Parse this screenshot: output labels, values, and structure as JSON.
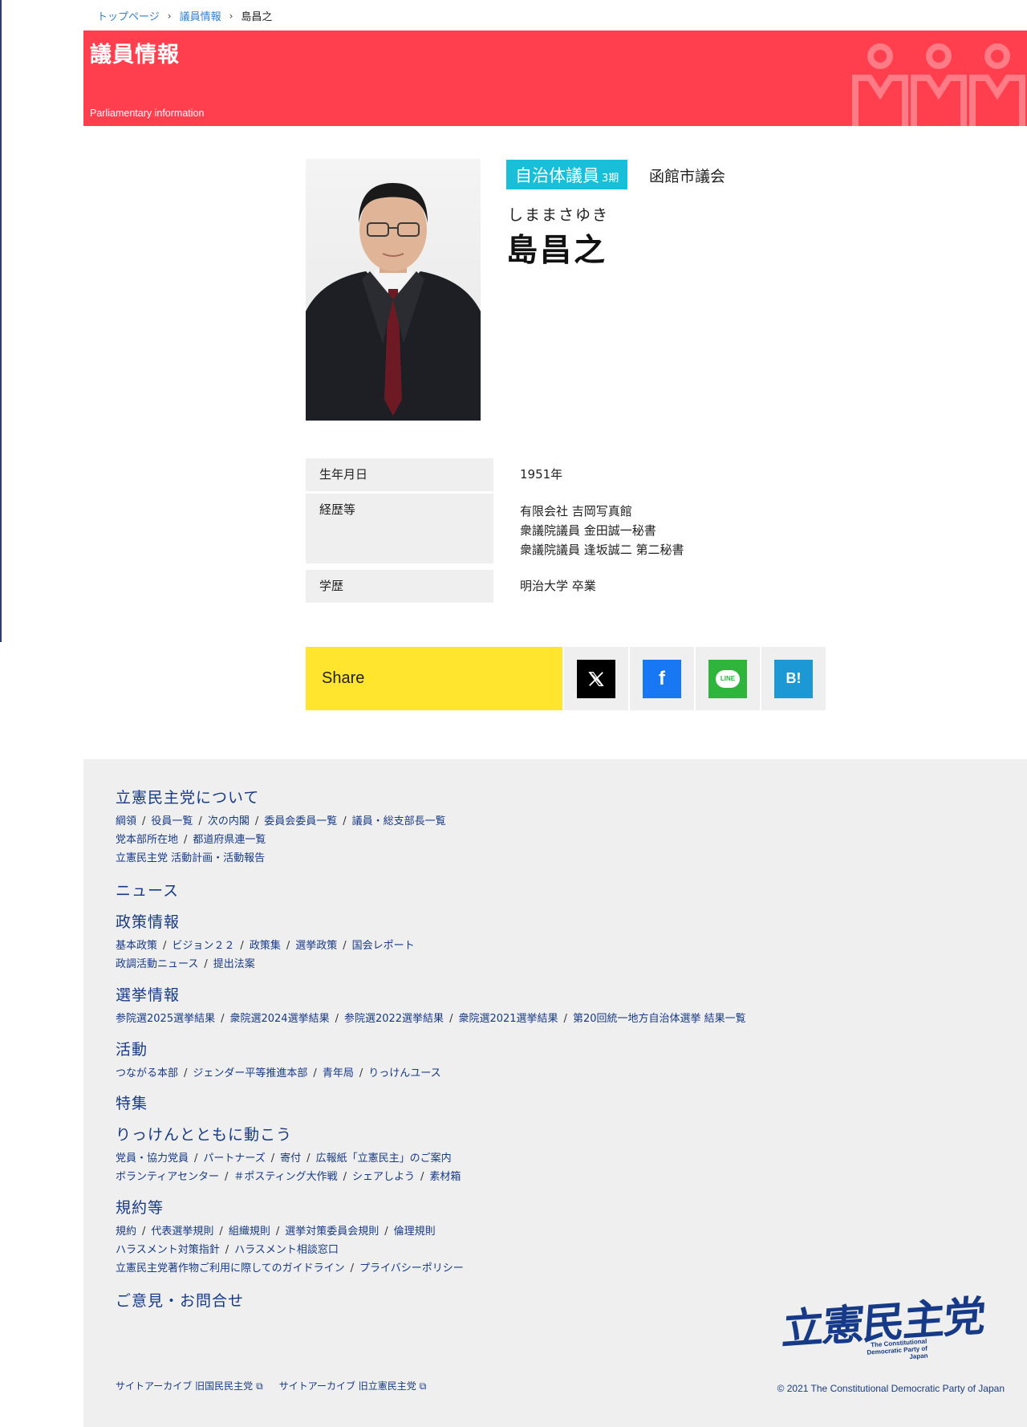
{
  "breadcrumb": {
    "items": [
      "トップページ",
      "議員情報"
    ],
    "current": "島昌之",
    "separator": "›"
  },
  "banner": {
    "title": "議員情報",
    "subtitle": "Parliamentary information",
    "color": "#ff3f4e"
  },
  "member": {
    "category": "自治体議員",
    "term": "3期",
    "assembly": "函館市議会",
    "kana": "しままさゆき",
    "name": "島昌之",
    "badge_color": "#19bfd9"
  },
  "profile": {
    "birth_label": "生年月日",
    "birth_value": "1951年",
    "career_label": "経歴等",
    "career_values": [
      "有限会社 吉岡写真館",
      "衆議院議員 金田誠一秘書",
      "衆議院議員 逢坂誠二 第二秘書"
    ],
    "education_label": "学歴",
    "education_value": "明治大学 卒業"
  },
  "share": {
    "label": "Share",
    "buttons": [
      {
        "icon": "x-icon",
        "color": "#000000"
      },
      {
        "icon": "facebook-icon",
        "glyph": "f",
        "color": "#1877f2"
      },
      {
        "icon": "line-icon",
        "glyph": "LINE",
        "color": "#2fb43c"
      },
      {
        "icon": "hatena-bookmark-icon",
        "glyph": "B!",
        "color": "#1c98d5"
      }
    ],
    "color": "#ffe52d"
  },
  "footer": {
    "sections": [
      {
        "title": "立憲民主党について",
        "lines": [
          [
            "綱領",
            "役員一覧",
            "次の内閣",
            "委員会委員一覧",
            "議員・総支部長一覧"
          ],
          [
            "党本部所在地",
            "都道府県連一覧"
          ],
          [
            "立憲民主党 活動計画・活動報告"
          ]
        ]
      },
      {
        "title": "ニュース",
        "lines": []
      },
      {
        "title": "政策情報",
        "lines": [
          [
            "基本政策",
            "ビジョン２２",
            "政策集",
            "選挙政策",
            "国会レポート"
          ],
          [
            "政調活動ニュース",
            "提出法案"
          ]
        ]
      },
      {
        "title": "選挙情報",
        "lines": [
          [
            "参院選2025選挙結果",
            "衆院選2024選挙結果",
            "参院選2022選挙結果",
            "衆院選2021選挙結果",
            "第20回統一地方自治体選挙 結果一覧"
          ]
        ]
      },
      {
        "title": "活動",
        "lines": [
          [
            "つながる本部",
            "ジェンダー平等推進本部",
            "青年局",
            "りっけんユース"
          ]
        ]
      },
      {
        "title": "特集",
        "lines": []
      },
      {
        "title": "りっけんとともに動こう",
        "lines": [
          [
            "党員・協力党員",
            "パートナーズ",
            "寄付",
            "広報紙「立憲民主」のご案内"
          ],
          [
            "ボランティアセンター",
            "＃ポスティング大作戦",
            "シェアしよう",
            "素材箱"
          ]
        ]
      },
      {
        "title": "規約等",
        "lines": [
          [
            "規約",
            "代表選挙規則",
            "組織規則",
            "選挙対策委員会規則",
            "倫理規則"
          ],
          [
            "ハラスメント対策指針",
            "ハラスメント相談窓口"
          ],
          [
            "立憲民主党著作物ご利用に際してのガイドライン",
            "プライバシーポリシー"
          ]
        ]
      },
      {
        "title": "ご意見・お問合せ",
        "lines": []
      }
    ],
    "archives": [
      "サイトアーカイブ 旧国民民主党",
      "サイトアーカイブ 旧立憲民主党"
    ],
    "copyright": "© 2021 The Constitutional Democratic Party of Japan",
    "logo": {
      "text": "立憲民主党",
      "sub1": "The Constitutional",
      "sub2": "Democratic Party of Japan"
    },
    "link_color": "#173a88",
    "bg_color": "#efefef"
  }
}
